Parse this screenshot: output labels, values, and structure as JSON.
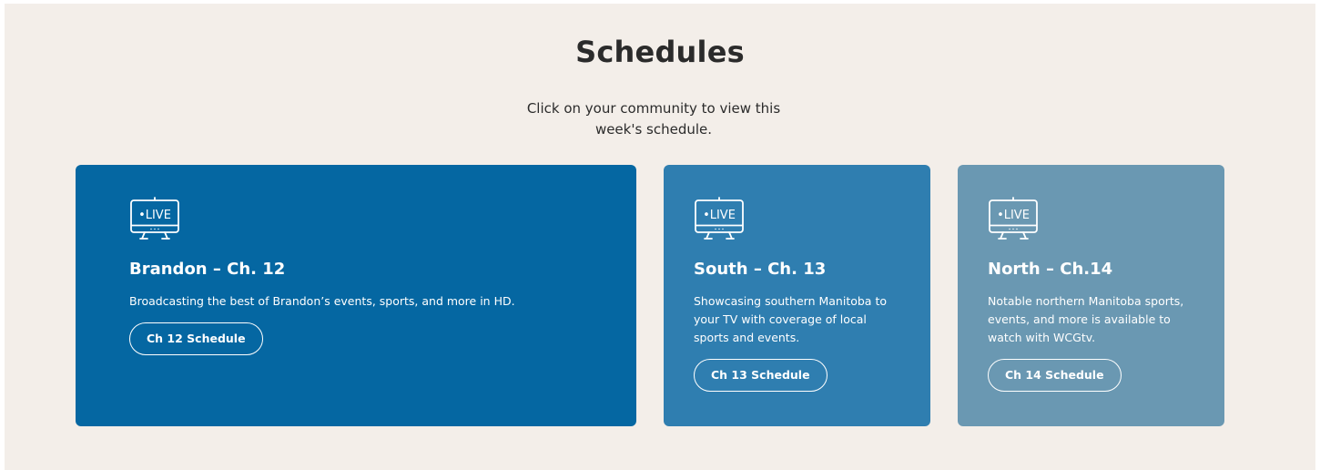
{
  "section": {
    "title": "Schedules",
    "subtitle": "Click on your community to view this week's schedule."
  },
  "cards": [
    {
      "icon": "live-tv-icon",
      "icon_text": "•LIVE",
      "title": "Brandon – Ch. 12",
      "description": "Broadcasting the best of Brandon’s events, sports, and more in HD.",
      "button_label": "Ch 12 Schedule",
      "color": "#0567a2"
    },
    {
      "icon": "live-tv-icon",
      "icon_text": "•LIVE",
      "title": "South – Ch. 13",
      "description": "Showcasing southern Manitoba to your TV with coverage of local sports and events.",
      "button_label": "Ch 13 Schedule",
      "color": "#2f7eb0"
    },
    {
      "icon": "live-tv-icon",
      "icon_text": "•LIVE",
      "title": "North – Ch.14",
      "description": "Notable northern Manitoba sports, events, and more is available to watch with WCGtv.",
      "button_label": "Ch 14 Schedule",
      "color": "#6a98b2"
    }
  ],
  "colors": {
    "background": "#f3eee9",
    "text": "#2b2b2b"
  }
}
